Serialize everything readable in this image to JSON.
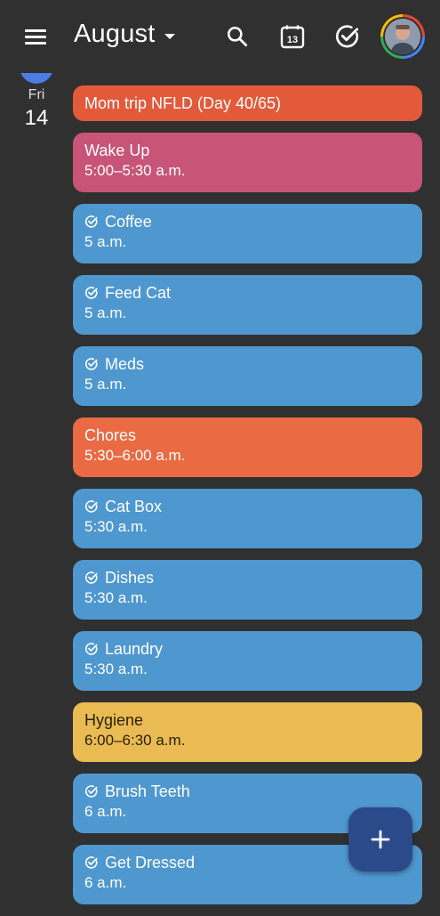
{
  "header": {
    "month": "August",
    "calendar_day_badge": "13"
  },
  "day": {
    "weekday": "Fri",
    "number": "14"
  },
  "events": [
    {
      "title": "Mom trip NFLD (Day 40/65)",
      "time": "",
      "task": false,
      "color": "#e35a3b",
      "text_color": "#ffffff"
    },
    {
      "title": "Wake Up",
      "time": "5:00–5:30 a.m.",
      "task": false,
      "color": "#c85478",
      "text_color": "#ffffff"
    },
    {
      "title": "Coffee",
      "time": "5 a.m.",
      "task": true,
      "color": "#4f98cf",
      "text_color": "#ffffff"
    },
    {
      "title": "Feed Cat",
      "time": "5 a.m.",
      "task": true,
      "color": "#4f98cf",
      "text_color": "#ffffff"
    },
    {
      "title": "Meds",
      "time": "5 a.m.",
      "task": true,
      "color": "#4f98cf",
      "text_color": "#ffffff"
    },
    {
      "title": "Chores",
      "time": "5:30–6:00 a.m.",
      "task": false,
      "color": "#e96a43",
      "text_color": "#ffffff"
    },
    {
      "title": "Cat Box",
      "time": "5:30 a.m.",
      "task": true,
      "color": "#4f98cf",
      "text_color": "#ffffff"
    },
    {
      "title": "Dishes",
      "time": "5:30 a.m.",
      "task": true,
      "color": "#4f98cf",
      "text_color": "#ffffff"
    },
    {
      "title": "Laundry",
      "time": "5:30 a.m.",
      "task": true,
      "color": "#4f98cf",
      "text_color": "#ffffff"
    },
    {
      "title": "Hygiene",
      "time": "6:00–6:30 a.m.",
      "task": false,
      "color": "#e9bb52",
      "text_color": "#2a1f08"
    },
    {
      "title": "Brush Teeth",
      "time": "6 a.m.",
      "task": true,
      "color": "#4f98cf",
      "text_color": "#ffffff"
    },
    {
      "title": "Get Dressed",
      "time": "6 a.m.",
      "task": true,
      "color": "#4f98cf",
      "text_color": "#ffffff"
    }
  ],
  "colors": {
    "background": "#303030",
    "today_dot": "#4a7ee6",
    "fab": "#2b4a8a"
  }
}
